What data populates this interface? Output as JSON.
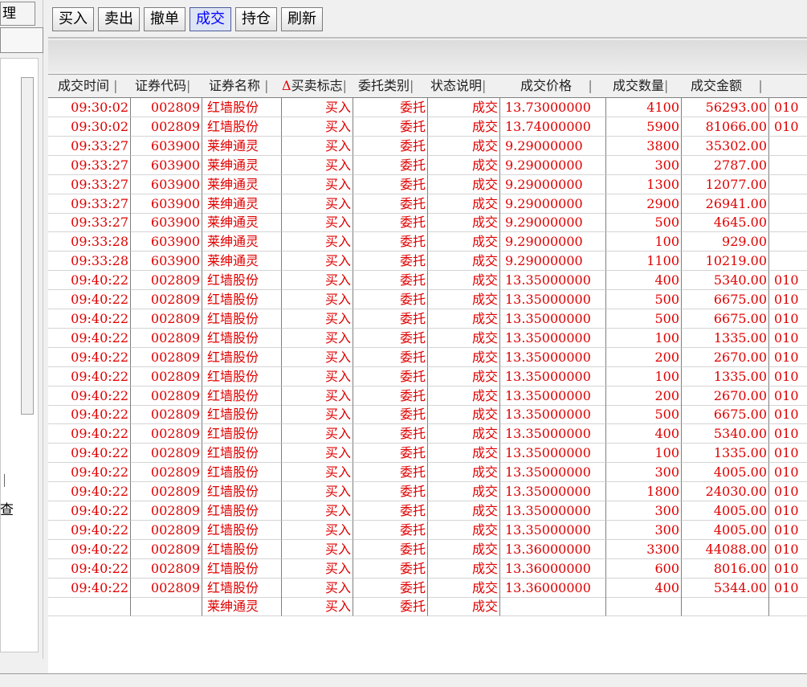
{
  "left_panel": {
    "tab_label": "理",
    "query_text": "查"
  },
  "toolbar": {
    "buttons": [
      {
        "label": "买入"
      },
      {
        "label": "卖出"
      },
      {
        "label": "撤单"
      },
      {
        "label": "成交",
        "active": true
      },
      {
        "label": "持仓"
      },
      {
        "label": "刷新"
      }
    ]
  },
  "table": {
    "headers": [
      "成交时间",
      "证券代码",
      "证券名称",
      "买卖标志",
      "委托类别",
      "状态说明",
      "成交价格",
      "成交数量",
      "成交金额"
    ],
    "sort_indicator": "Δ",
    "rows": [
      [
        "09:30:02",
        "002809",
        "红墙股份",
        "买入",
        "委托",
        "成交",
        "13.73000000",
        "4100",
        "56293.00",
        "010"
      ],
      [
        "09:30:02",
        "002809",
        "红墙股份",
        "买入",
        "委托",
        "成交",
        "13.74000000",
        "5900",
        "81066.00",
        "010"
      ],
      [
        "09:33:27",
        "603900",
        "莱绅通灵",
        "买入",
        "委托",
        "成交",
        "9.29000000",
        "3800",
        "35302.00",
        ""
      ],
      [
        "09:33:27",
        "603900",
        "莱绅通灵",
        "买入",
        "委托",
        "成交",
        "9.29000000",
        "300",
        "2787.00",
        ""
      ],
      [
        "09:33:27",
        "603900",
        "莱绅通灵",
        "买入",
        "委托",
        "成交",
        "9.29000000",
        "1300",
        "12077.00",
        ""
      ],
      [
        "09:33:27",
        "603900",
        "莱绅通灵",
        "买入",
        "委托",
        "成交",
        "9.29000000",
        "2900",
        "26941.00",
        ""
      ],
      [
        "09:33:27",
        "603900",
        "莱绅通灵",
        "买入",
        "委托",
        "成交",
        "9.29000000",
        "500",
        "4645.00",
        ""
      ],
      [
        "09:33:28",
        "603900",
        "莱绅通灵",
        "买入",
        "委托",
        "成交",
        "9.29000000",
        "100",
        "929.00",
        ""
      ],
      [
        "09:33:28",
        "603900",
        "莱绅通灵",
        "买入",
        "委托",
        "成交",
        "9.29000000",
        "1100",
        "10219.00",
        ""
      ],
      [
        "09:40:22",
        "002809",
        "红墙股份",
        "买入",
        "委托",
        "成交",
        "13.35000000",
        "400",
        "5340.00",
        "010"
      ],
      [
        "09:40:22",
        "002809",
        "红墙股份",
        "买入",
        "委托",
        "成交",
        "13.35000000",
        "500",
        "6675.00",
        "010"
      ],
      [
        "09:40:22",
        "002809",
        "红墙股份",
        "买入",
        "委托",
        "成交",
        "13.35000000",
        "500",
        "6675.00",
        "010"
      ],
      [
        "09:40:22",
        "002809",
        "红墙股份",
        "买入",
        "委托",
        "成交",
        "13.35000000",
        "100",
        "1335.00",
        "010"
      ],
      [
        "09:40:22",
        "002809",
        "红墙股份",
        "买入",
        "委托",
        "成交",
        "13.35000000",
        "200",
        "2670.00",
        "010"
      ],
      [
        "09:40:22",
        "002809",
        "红墙股份",
        "买入",
        "委托",
        "成交",
        "13.35000000",
        "100",
        "1335.00",
        "010"
      ],
      [
        "09:40:22",
        "002809",
        "红墙股份",
        "买入",
        "委托",
        "成交",
        "13.35000000",
        "200",
        "2670.00",
        "010"
      ],
      [
        "09:40:22",
        "002809",
        "红墙股份",
        "买入",
        "委托",
        "成交",
        "13.35000000",
        "500",
        "6675.00",
        "010"
      ],
      [
        "09:40:22",
        "002809",
        "红墙股份",
        "买入",
        "委托",
        "成交",
        "13.35000000",
        "400",
        "5340.00",
        "010"
      ],
      [
        "09:40:22",
        "002809",
        "红墙股份",
        "买入",
        "委托",
        "成交",
        "13.35000000",
        "100",
        "1335.00",
        "010"
      ],
      [
        "09:40:22",
        "002809",
        "红墙股份",
        "买入",
        "委托",
        "成交",
        "13.35000000",
        "300",
        "4005.00",
        "010"
      ],
      [
        "09:40:22",
        "002809",
        "红墙股份",
        "买入",
        "委托",
        "成交",
        "13.35000000",
        "1800",
        "24030.00",
        "010"
      ],
      [
        "09:40:22",
        "002809",
        "红墙股份",
        "买入",
        "委托",
        "成交",
        "13.35000000",
        "300",
        "4005.00",
        "010"
      ],
      [
        "09:40:22",
        "002809",
        "红墙股份",
        "买入",
        "委托",
        "成交",
        "13.35000000",
        "300",
        "4005.00",
        "010"
      ],
      [
        "09:40:22",
        "002809",
        "红墙股份",
        "买入",
        "委托",
        "成交",
        "13.36000000",
        "3300",
        "44088.00",
        "010"
      ],
      [
        "09:40:22",
        "002809",
        "红墙股份",
        "买入",
        "委托",
        "成交",
        "13.36000000",
        "600",
        "8016.00",
        "010"
      ],
      [
        "09:40:22",
        "002809",
        "红墙股份",
        "买入",
        "委托",
        "成交",
        "13.36000000",
        "400",
        "5344.00",
        "010"
      ],
      [
        "",
        "",
        "莱绅通灵",
        "买入",
        "委托",
        "成交",
        "",
        "",
        "",
        ""
      ]
    ]
  },
  "colors": {
    "row_text": "#e00000",
    "active_button_text": "#0000ff"
  }
}
